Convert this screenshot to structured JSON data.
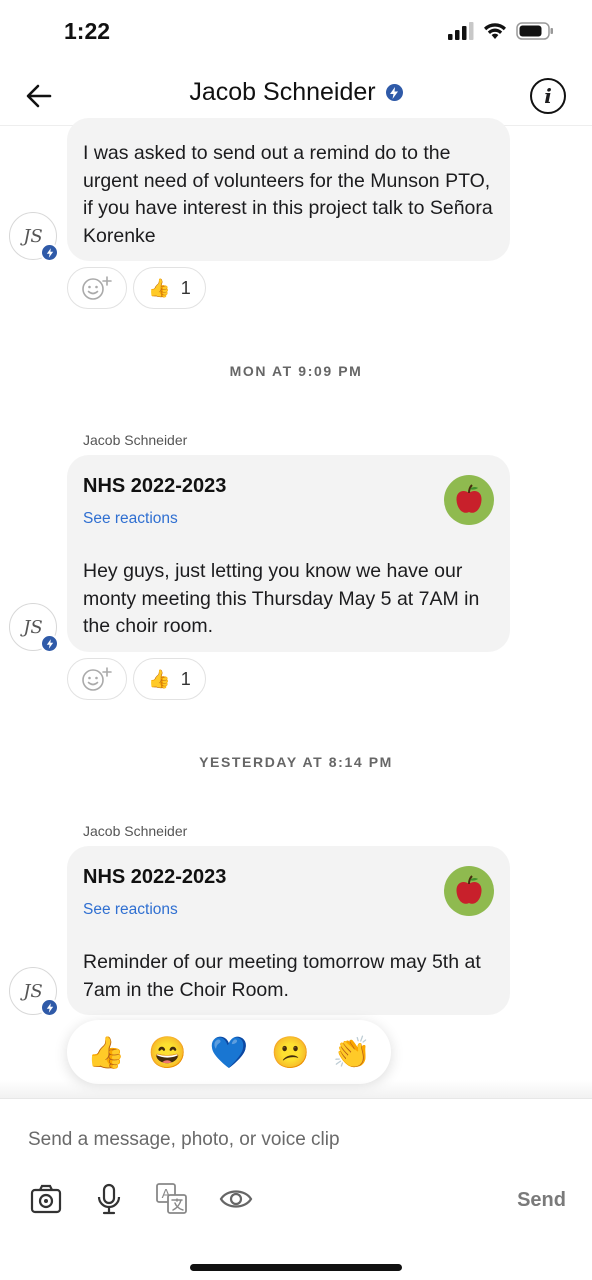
{
  "status_bar": {
    "time": "1:22"
  },
  "header": {
    "title": "Jacob Schneider",
    "back_icon": "arrow-left-icon",
    "info_icon": "info-icon"
  },
  "messages": [
    {
      "avatar_initials": "JS",
      "text": "I was asked to send out a remind do to the urgent need of volunteers for the Munson PTO, if you have interest in this project talk to Señora Korenke",
      "reaction": {
        "emoji": "👍",
        "count": "1"
      }
    },
    {
      "day_separator": "MON AT 9:09 PM",
      "sender": "Jacob Schneider",
      "avatar_initials": "JS",
      "class_name": "NHS 2022-2023",
      "see_reactions": "See reactions",
      "text": "Hey guys, just letting you know we have our monty meeting this Thursday May 5 at 7AM in the choir room.",
      "reaction": {
        "emoji": "👍",
        "count": "1"
      }
    },
    {
      "day_separator": "YESTERDAY AT 8:14 PM",
      "sender": "Jacob Schneider",
      "avatar_initials": "JS",
      "class_name": "NHS 2022-2023",
      "see_reactions": "See reactions",
      "text": "Reminder of our meeting tomorrow may 5th at 7am in the Choir Room."
    }
  ],
  "emoji_picker": [
    "👍",
    "😄",
    "💙",
    "😕",
    "👏"
  ],
  "composer": {
    "placeholder": "Send a message, photo, or voice clip",
    "send_label": "Send",
    "tools": [
      "camera-icon",
      "microphone-icon",
      "translate-icon",
      "eye-icon"
    ]
  },
  "colors": {
    "accent": "#2f5aa8",
    "link": "#2f6fd1",
    "bubble": "#f3f3f3",
    "class_icon_bg": "#8fba4f"
  }
}
